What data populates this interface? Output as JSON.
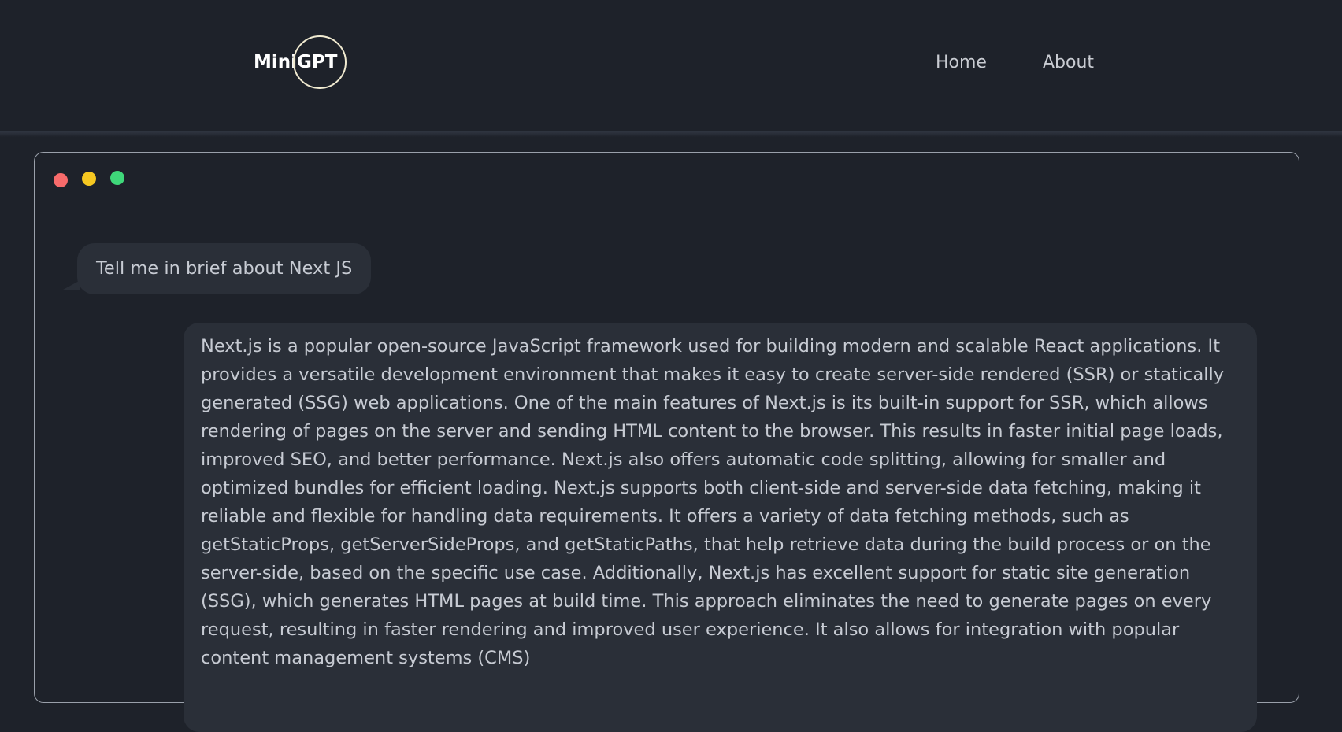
{
  "header": {
    "logo_text": "MiniGPT",
    "nav": {
      "home_label": "Home",
      "about_label": "About"
    }
  },
  "chat_window": {
    "controls": [
      "close",
      "minimize",
      "maximize"
    ],
    "colors": {
      "close": "#f86b6b",
      "minimize": "#f6c821",
      "maximize": "#3fd87a"
    },
    "messages": [
      {
        "role": "user",
        "text": "Tell me in brief about Next JS"
      },
      {
        "role": "assistant",
        "text": "Next.js is a popular open-source JavaScript framework used for building modern and scalable React applications. It provides a versatile development environment that makes it easy to create server-side rendered (SSR) or statically generated (SSG) web applications. One of the main features of Next.js is its built-in support for SSR, which allows rendering of pages on the server and sending HTML content to the browser. This results in faster initial page loads, improved SEO, and better performance. Next.js also offers automatic code splitting, allowing for smaller and optimized bundles for efficient loading. Next.js supports both client-side and server-side data fetching, making it reliable and flexible for handling data requirements. It offers a variety of data fetching methods, such as getStaticProps, getServerSideProps, and getStaticPaths, that help retrieve data during the build process or on the server-side, based on the specific use case. Additionally, Next.js has excellent support for static site generation (SSG), which generates HTML pages at build time. This approach eliminates the need to generate pages on every request, resulting in faster rendering and improved user experience. It also allows for integration with popular content management systems (CMS)"
      }
    ]
  }
}
